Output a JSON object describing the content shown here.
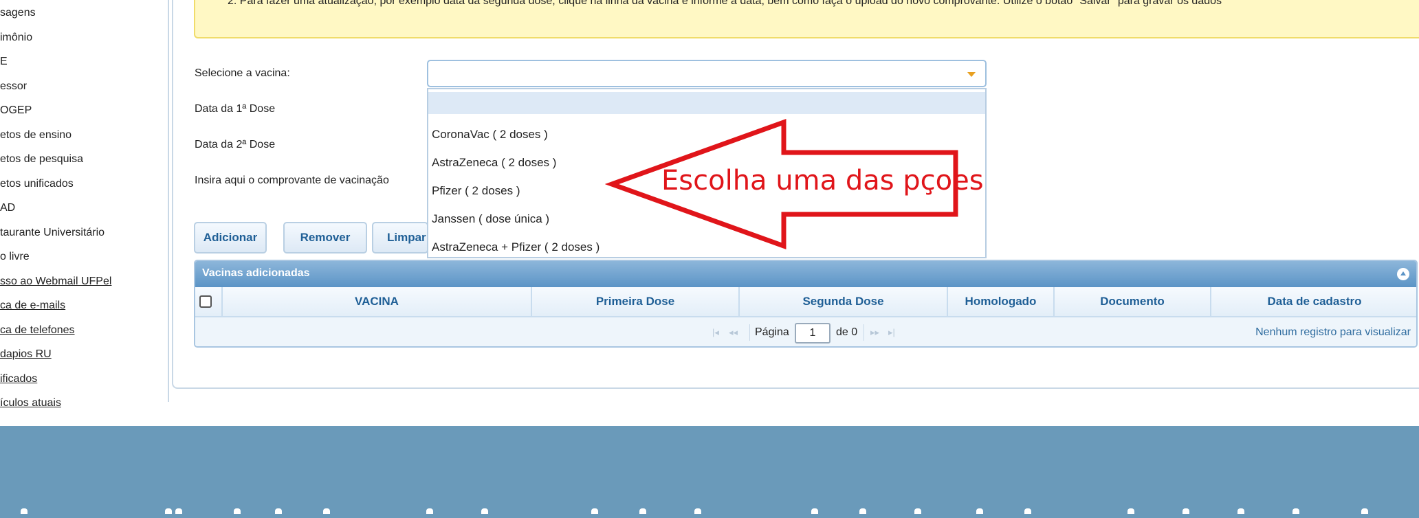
{
  "sidebar": {
    "items": [
      {
        "label": "sagens",
        "link": false
      },
      {
        "label": "imônio",
        "link": false
      },
      {
        "label": "E",
        "link": false
      },
      {
        "label": "essor",
        "link": false
      },
      {
        "label": "OGEP",
        "link": false
      },
      {
        "label": "etos de ensino",
        "link": false
      },
      {
        "label": "etos de pesquisa",
        "link": false
      },
      {
        "label": "etos unificados",
        "link": false
      },
      {
        "label": "AD",
        "link": false
      },
      {
        "label": "taurante Universitário",
        "link": false
      },
      {
        "label": "o livre",
        "link": false
      },
      {
        "label": "sso ao Webmail UFPel",
        "link": true
      },
      {
        "label": "ca de e-mails",
        "link": true
      },
      {
        "label": "ca de telefones",
        "link": true
      },
      {
        "label": "dapios RU",
        "link": true
      },
      {
        "label": "ificados",
        "link": true
      },
      {
        "label": "ículos atuais",
        "link": true
      }
    ]
  },
  "notice": {
    "line2": "2. Para fazer uma atualização, por exemplo data da segunda dose, clique na linha da vacina e informe a data, bem como faça o upload do novo comprovante. Utilize o botão \"Salvar\" para gravar os dados"
  },
  "form": {
    "select_label": "Selecione a vacina:",
    "dose1_label": "Data da 1ª Dose",
    "dose2_label": "Data da 2ª Dose",
    "upload_label": "Insira aqui o comprovante de vacinação",
    "select_value": "",
    "options": [
      "",
      "CoronaVac ( 2 doses )",
      "AstraZeneca ( 2 doses )",
      "Pfizer ( 2 doses )",
      "Janssen ( dose única )",
      "AstraZeneca + Pfizer ( 2 doses )"
    ]
  },
  "buttons": {
    "add": "Adicionar",
    "remove": "Remover",
    "clear": "Limpar"
  },
  "annotation": {
    "text": "Escolha uma das pçoes",
    "color": "#e0151a"
  },
  "grid": {
    "title": "Vacinas adicionadas",
    "columns": [
      "VACINA",
      "Primeira Dose",
      "Segunda Dose",
      "Homologado",
      "Documento",
      "Data de cadastro"
    ],
    "pager": {
      "page_label": "Página",
      "page_value": "1",
      "of_label": "de 0",
      "empty_text": "Nenhum registro para visualizar"
    }
  },
  "colors": {
    "accent": "#1f5f96",
    "header_blue": "#5b94c6",
    "notice_bg": "#fff8c4",
    "band": "#6a9aba"
  }
}
